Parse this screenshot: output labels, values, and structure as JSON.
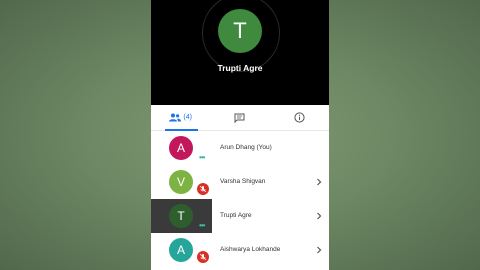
{
  "presenter": {
    "initial": "T",
    "name": "Trupti Agre",
    "color": "#3f8a3f"
  },
  "tabs": {
    "people_count": "(4)",
    "accent": "#1a73e8"
  },
  "participants": [
    {
      "initial": "A",
      "name": "Arun Dhang (You)",
      "color": "#c2185b",
      "speaking": true,
      "muted": false,
      "chevron": false,
      "highlight": false
    },
    {
      "initial": "V",
      "name": "Varsha Shigvan",
      "color": "#7cb342",
      "speaking": false,
      "muted": true,
      "chevron": true,
      "highlight": false
    },
    {
      "initial": "T",
      "name": "Trupti Agre",
      "color": "#2e5d2e",
      "speaking": true,
      "muted": false,
      "chevron": true,
      "highlight": true
    },
    {
      "initial": "A",
      "name": "Aishwarya Lokhande",
      "color": "#26a69a",
      "speaking": false,
      "muted": true,
      "chevron": true,
      "highlight": false
    }
  ]
}
